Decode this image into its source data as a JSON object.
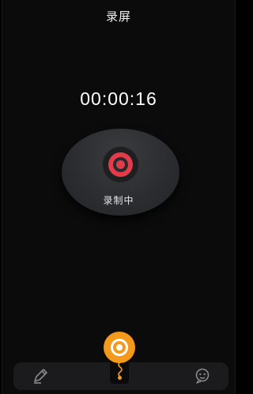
{
  "header": {
    "title": "录屏"
  },
  "recorder": {
    "elapsed": "00:00:16",
    "status_label": "录制中"
  },
  "toolbar": {
    "left_icon": "pencil-icon",
    "center_icon": "screen-record-fab-icon",
    "right_icon": "face-icon"
  },
  "colors": {
    "background": "#0b0b0c",
    "record_red": "#e23b4a",
    "accent_orange": "#f39a1c",
    "disc": "#2b2d30"
  }
}
